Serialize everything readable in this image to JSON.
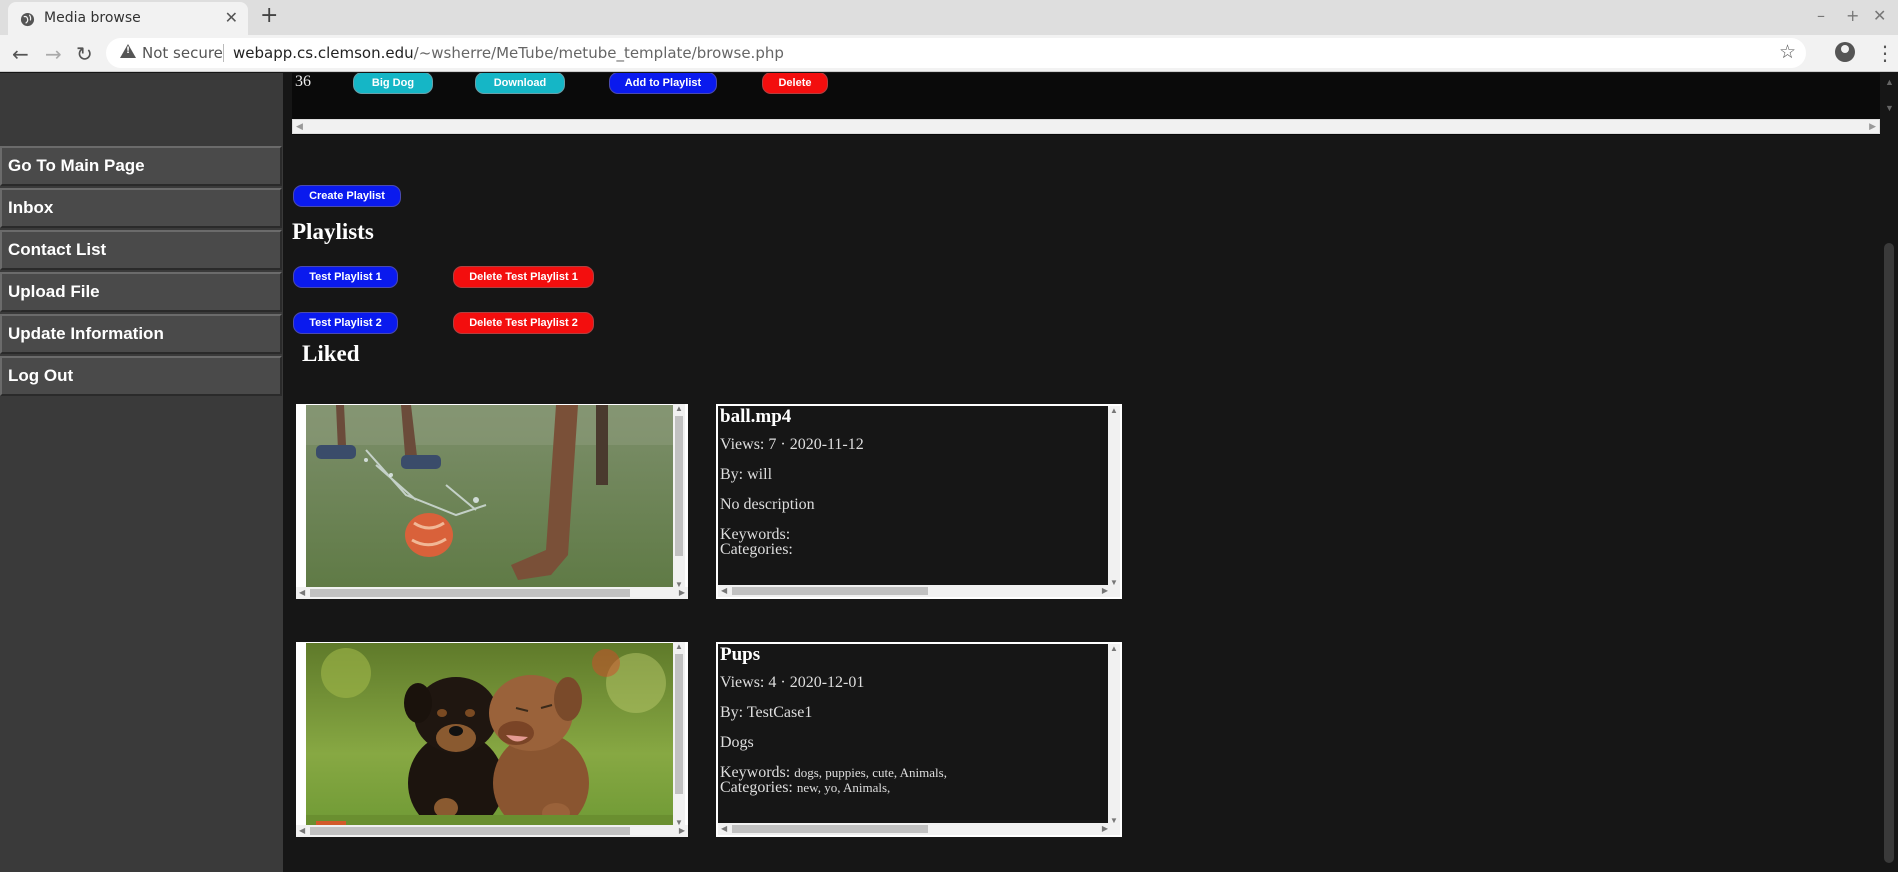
{
  "browser": {
    "tab_title": "Media browse",
    "new_tab": "+",
    "tab_close": "✕",
    "security_label": "Not secure",
    "url_host": "webapp.cs.clemson.edu",
    "url_path": "/~wsherre/MeTube/metube_template/browse.php",
    "window_controls": {
      "minimize": "–",
      "maximize": "+",
      "close": "✕"
    }
  },
  "sidebar": {
    "items": [
      {
        "label": "Go To Main Page"
      },
      {
        "label": "Inbox"
      },
      {
        "label": "Contact List"
      },
      {
        "label": "Upload File"
      },
      {
        "label": "Update Information"
      },
      {
        "label": "Log Out"
      }
    ]
  },
  "top_row": {
    "number": "36",
    "title_button": "Big Dog",
    "download_button": "Download",
    "add_to_playlist_button": "Add to Playlist",
    "delete_button": "Delete"
  },
  "playlists": {
    "create_button": "Create Playlist",
    "heading": "Playlists",
    "items": [
      {
        "label": "Test Playlist 1",
        "delete_label": "Delete Test Playlist 1"
      },
      {
        "label": "Test Playlist 2",
        "delete_label": "Delete Test Playlist 2"
      }
    ]
  },
  "liked": {
    "heading": "Liked",
    "items": [
      {
        "title": "ball.mp4",
        "views": "Views: 7 · 2020-11-12",
        "by": "By: will",
        "description": "No description",
        "keywords_label": "Keywords:",
        "keywords": "",
        "categories_label": "Categories:",
        "categories": ""
      },
      {
        "title": "Pups",
        "views": "Views: 4 · 2020-12-01",
        "by": "By: TestCase1",
        "description": "Dogs",
        "keywords_label": "Keywords:",
        "keywords": "dogs, puppies, cute, Animals,",
        "categories_label": "Categories:",
        "categories": "new, yo, Animals,"
      }
    ]
  },
  "colors": {
    "page_bg": "#161616",
    "sidebar_bg": "#3a3a3a",
    "button_blue": "#0a1aee",
    "button_red": "#f30e0e",
    "button_cyan": "#15b6c6"
  }
}
